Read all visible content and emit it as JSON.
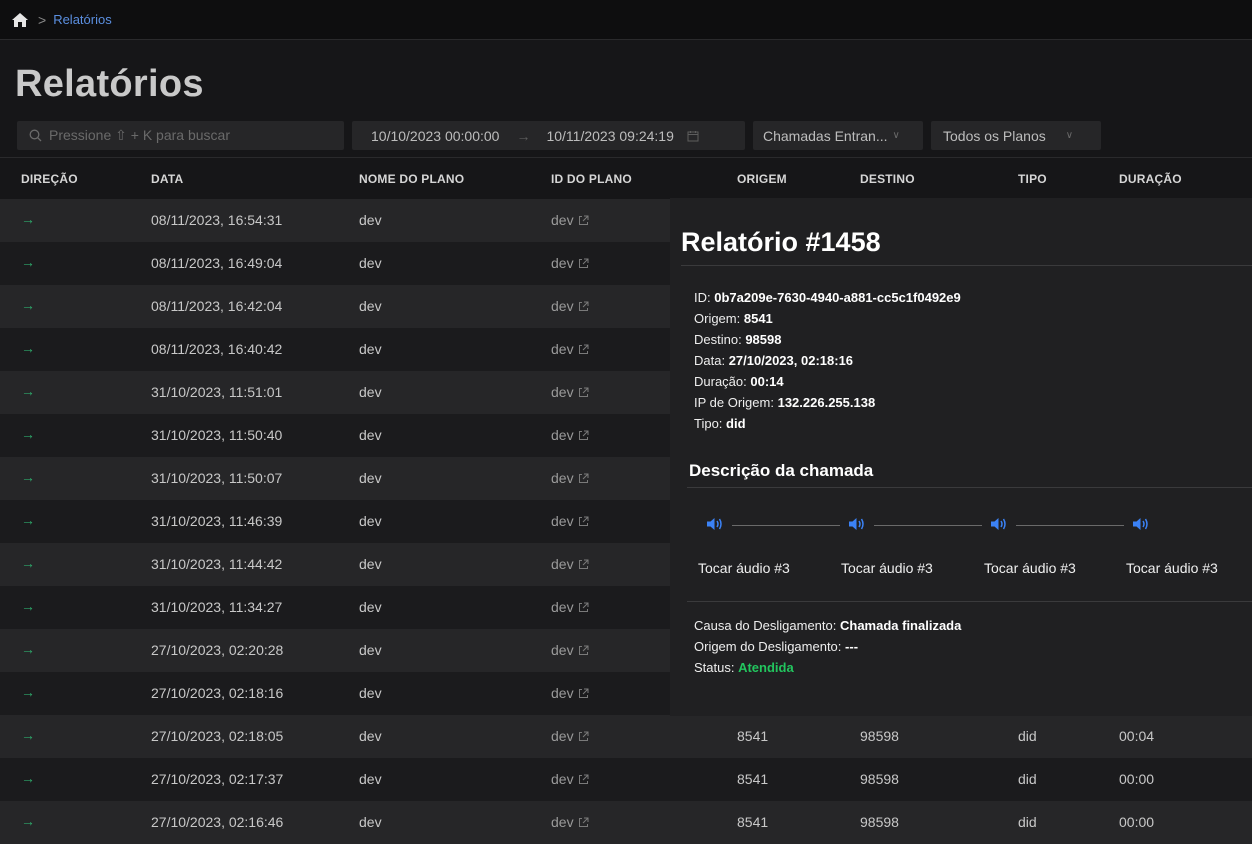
{
  "breadcrumb": {
    "current": "Relatórios"
  },
  "page_title": "Relatórios",
  "filters": {
    "search_placeholder": "Pressione ⇧ + K para buscar",
    "date_start": "10/10/2023 00:00:00",
    "date_end": "10/11/2023 09:24:19",
    "call_type": "Chamadas Entran...",
    "plans": "Todos os Planos"
  },
  "columns": {
    "direction": "DIREÇÃO",
    "date": "DATA",
    "plan_name": "NOME DO PLANO",
    "plan_id": "ID DO PLANO",
    "origin": "ORIGEM",
    "destination": "DESTINO",
    "type": "TIPO",
    "duration": "DURAÇÃO"
  },
  "rows": [
    {
      "dir": "→",
      "date": "08/11/2023, 16:54:31",
      "plan_name": "dev",
      "plan_id": "dev",
      "origin": "",
      "destination": "",
      "type": "",
      "duration": ""
    },
    {
      "dir": "→",
      "date": "08/11/2023, 16:49:04",
      "plan_name": "dev",
      "plan_id": "dev",
      "origin": "",
      "destination": "",
      "type": "",
      "duration": ""
    },
    {
      "dir": "→",
      "date": "08/11/2023, 16:42:04",
      "plan_name": "dev",
      "plan_id": "dev",
      "origin": "",
      "destination": "",
      "type": "",
      "duration": ""
    },
    {
      "dir": "→",
      "date": "08/11/2023, 16:40:42",
      "plan_name": "dev",
      "plan_id": "dev",
      "origin": "",
      "destination": "",
      "type": "",
      "duration": ""
    },
    {
      "dir": "→",
      "date": "31/10/2023, 11:51:01",
      "plan_name": "dev",
      "plan_id": "dev",
      "origin": "",
      "destination": "",
      "type": "",
      "duration": ""
    },
    {
      "dir": "→",
      "date": "31/10/2023, 11:50:40",
      "plan_name": "dev",
      "plan_id": "dev",
      "origin": "",
      "destination": "",
      "type": "",
      "duration": ""
    },
    {
      "dir": "→",
      "date": "31/10/2023, 11:50:07",
      "plan_name": "dev",
      "plan_id": "dev",
      "origin": "",
      "destination": "",
      "type": "",
      "duration": ""
    },
    {
      "dir": "→",
      "date": "31/10/2023, 11:46:39",
      "plan_name": "dev",
      "plan_id": "dev",
      "origin": "",
      "destination": "",
      "type": "",
      "duration": ""
    },
    {
      "dir": "→",
      "date": "31/10/2023, 11:44:42",
      "plan_name": "dev",
      "plan_id": "dev",
      "origin": "",
      "destination": "",
      "type": "",
      "duration": ""
    },
    {
      "dir": "→",
      "date": "31/10/2023, 11:34:27",
      "plan_name": "dev",
      "plan_id": "dev",
      "origin": "",
      "destination": "",
      "type": "",
      "duration": ""
    },
    {
      "dir": "→",
      "date": "27/10/2023, 02:20:28",
      "plan_name": "dev",
      "plan_id": "dev",
      "origin": "",
      "destination": "",
      "type": "",
      "duration": ""
    },
    {
      "dir": "→",
      "date": "27/10/2023, 02:18:16",
      "plan_name": "dev",
      "plan_id": "dev",
      "origin": "",
      "destination": "",
      "type": "",
      "duration": ""
    },
    {
      "dir": "→",
      "date": "27/10/2023, 02:18:05",
      "plan_name": "dev",
      "plan_id": "dev",
      "origin": "8541",
      "destination": "98598",
      "type": "did",
      "duration": "00:04"
    },
    {
      "dir": "→",
      "date": "27/10/2023, 02:17:37",
      "plan_name": "dev",
      "plan_id": "dev",
      "origin": "8541",
      "destination": "98598",
      "type": "did",
      "duration": "00:00"
    },
    {
      "dir": "→",
      "date": "27/10/2023, 02:16:46",
      "plan_name": "dev",
      "plan_id": "dev",
      "origin": "8541",
      "destination": "98598",
      "type": "did",
      "duration": "00:00"
    }
  ],
  "report": {
    "title": "Relatório #1458",
    "id_label": "ID:",
    "id": "0b7a209e-7630-4940-a881-cc5c1f0492e9",
    "origin_label": "Origem:",
    "origin": "8541",
    "destination_label": "Destino:",
    "destination": "98598",
    "date_label": "Data:",
    "date": "27/10/2023, 02:18:16",
    "duration_label": "Duração:",
    "duration": "00:14",
    "ip_label": "IP de Origem:",
    "ip": "132.226.255.138",
    "type_label": "Tipo:",
    "type": "did",
    "description_title": "Descrição da chamada",
    "audio_labels": [
      "Tocar áudio #3",
      "Tocar áudio #3",
      "Tocar áudio #3",
      "Tocar áudio #3"
    ],
    "hangup_cause_label": "Causa do Desligamento:",
    "hangup_cause": "Chamada finalizada",
    "hangup_origin_label": "Origem do Desligamento:",
    "hangup_origin": "---",
    "status_label": "Status:",
    "status": "Atendida"
  },
  "colors": {
    "accent": "#5b8fe0",
    "direction_arrow": "#2ea86a",
    "status_answered": "#22c55e",
    "speaker": "#3b82f6"
  },
  "icons": [
    "home-icon",
    "search-icon",
    "calendar-icon",
    "chevron-down-icon",
    "external-link-icon",
    "speaker-icon"
  ]
}
